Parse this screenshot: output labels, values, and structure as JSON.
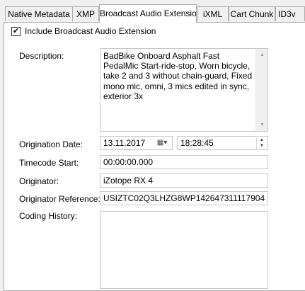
{
  "tabs": [
    {
      "label": "Native Metadata"
    },
    {
      "label": "XMP"
    },
    {
      "label": "Broadcast Audio Extension"
    },
    {
      "label": "iXML"
    },
    {
      "label": "Cart Chunk"
    },
    {
      "label": "ID3v"
    }
  ],
  "include_checkbox": {
    "checked": true,
    "label": "Include Broadcast Audio Extension"
  },
  "description": {
    "label": "Description:",
    "value": "BadBike Onboard Asphalt Fast PedalMic Start-ride-stop, Worn bicycle, take 2 and 3 without chain-guard, Fixed mono mic, omni, 3 mics edited in sync, exterior 3x"
  },
  "origination": {
    "label": "Origination Date:",
    "date": "13.11.2017",
    "time": "18:28:45"
  },
  "timecode": {
    "label": "Timecode Start:",
    "value": "00:00:00.000"
  },
  "originator": {
    "label": "Originator:",
    "value": "iZotope RX 4"
  },
  "originator_reference": {
    "label": "Originator Reference:",
    "value": "USIZTC02Q3LHZG8WP142647311117904"
  },
  "coding_history": {
    "label": "Coding History:",
    "value": ""
  },
  "icons": {
    "check": "✔",
    "calendar": "▦▾",
    "up": "▲",
    "down": "▼"
  }
}
